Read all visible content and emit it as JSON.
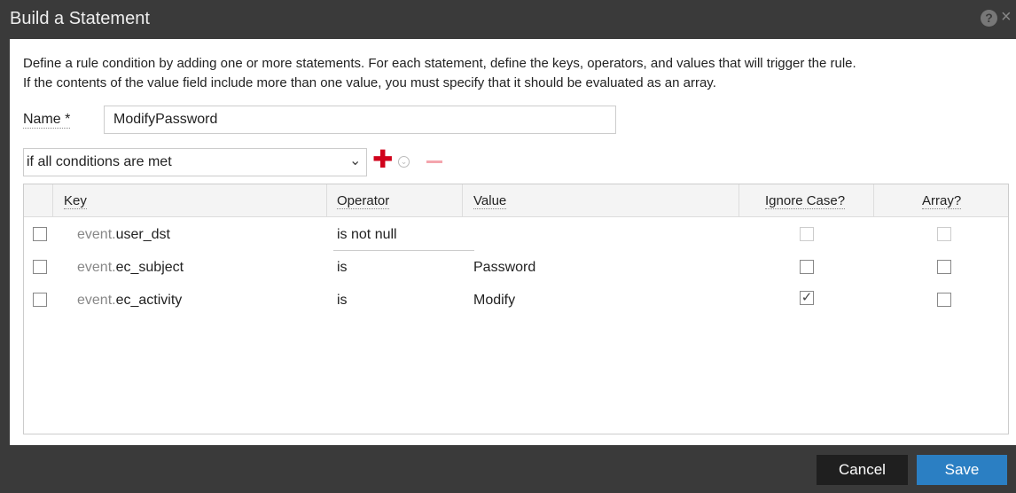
{
  "dialog": {
    "title": "Build a Statement",
    "description_line1": "Define a rule condition by adding one or more statements. For each statement, define the keys, operators, and values that will trigger the rule.",
    "description_line2": "If the contents of the value field include more than one value, you must specify that it should be evaluated as an array.",
    "name_label": "Name *",
    "name_value": "ModifyPassword",
    "condition_selected": "if all conditions are met",
    "icons": {
      "help": "help-icon",
      "close": "close-icon",
      "add": "plus-icon",
      "more": "chevron-down-circle-icon",
      "remove": "minus-icon"
    },
    "colors": {
      "accent_add": "#d0021b",
      "save_button": "#2b7fc3",
      "titlebar": "#3a3a3a"
    }
  },
  "grid": {
    "headers": {
      "key": "Key",
      "operator": "Operator",
      "value": "Value",
      "ignore_case": "Ignore Case?",
      "array": "Array?"
    },
    "rows": [
      {
        "selected": false,
        "key_prefix": "event.",
        "key_name": "user_dst",
        "operator": "is not null",
        "value": "",
        "ignore_case": false,
        "ignore_case_enabled": false,
        "array": false,
        "array_enabled": false
      },
      {
        "selected": false,
        "key_prefix": "event.",
        "key_name": "ec_subject",
        "operator": "is",
        "value": "Password",
        "ignore_case": false,
        "ignore_case_enabled": true,
        "array": false,
        "array_enabled": true
      },
      {
        "selected": false,
        "key_prefix": "event.",
        "key_name": "ec_activity",
        "operator": "is",
        "value": "Modify",
        "ignore_case": true,
        "ignore_case_enabled": true,
        "array": false,
        "array_enabled": true
      }
    ]
  },
  "footer": {
    "cancel_label": "Cancel",
    "save_label": "Save"
  }
}
